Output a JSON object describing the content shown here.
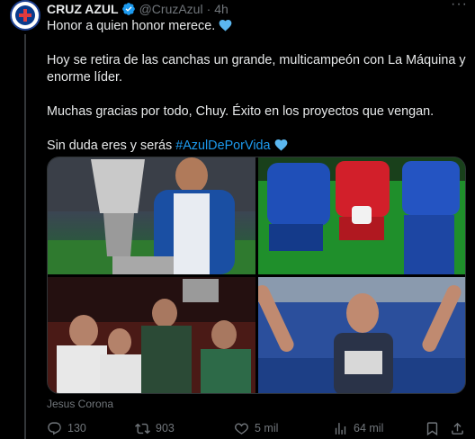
{
  "post": {
    "author_name": "CRUZ AZUL",
    "handle": "@CruzAzul",
    "separator": "·",
    "time": "4h",
    "more_label": "···",
    "paragraphs": {
      "p1": "Honor a quien honor merece.",
      "p2": "Hoy se retira de las canchas un grande, multicampeón con La Máquina y enorme líder.",
      "p3": "Muchas gracias por todo, Chuy. Éxito en los proyectos que vengan.",
      "p4_prefix": "Sin duda eres y serás",
      "p4_hashtag": "#AzulDePorVida"
    },
    "media_credit": "Jesus Corona"
  },
  "actions": {
    "replies": "130",
    "reposts": "903",
    "likes": "5 mil",
    "views": "64 mil"
  },
  "colors": {
    "accent": "#1d9bf0",
    "heart": "#5bb7f0",
    "muted": "#71767b"
  }
}
